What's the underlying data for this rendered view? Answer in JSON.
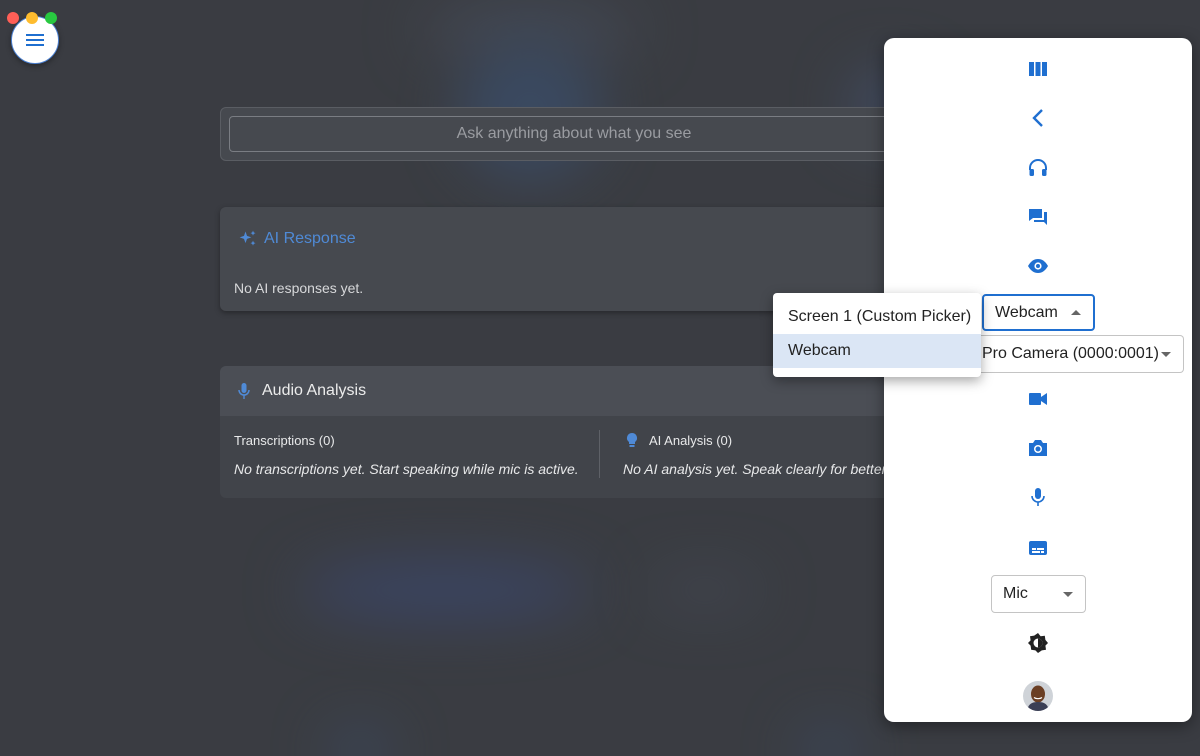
{
  "window_controls": [
    "close",
    "minimize",
    "maximize"
  ],
  "menu_button": {
    "icon": "hamburger-menu-icon"
  },
  "ask": {
    "placeholder": "Ask anything about what you see"
  },
  "ai_response": {
    "title": "AI Response",
    "icon": "sparkle-icon",
    "empty_text": "No AI responses yet."
  },
  "audio_analysis": {
    "title": "Audio Analysis",
    "transcriptions_header": "Transcriptions (0)",
    "transcriptions_empty": "No transcriptions yet. Start speaking while mic is active.",
    "ai_analysis_header": "AI Analysis (0)",
    "ai_analysis_empty": "No AI analysis yet. Speak clearly for better"
  },
  "side_panel": {
    "icons": [
      "columns-icon",
      "chevron-left-icon",
      "headset-icon",
      "forum-icon",
      "eye-icon",
      "videocam-icon",
      "camera-icon",
      "mic-icon",
      "subtitles-icon",
      "brightness-icon"
    ],
    "source_select": {
      "value": "Webcam"
    },
    "camera_select": {
      "value": "Pro Camera (0000:0001)"
    },
    "audio_select": {
      "value": "Mic"
    }
  },
  "source_dropdown": {
    "options": [
      "Screen 1 (Custom Picker)",
      "Webcam"
    ],
    "selected": "Webcam"
  },
  "colors": {
    "accent": "#1f6fd0",
    "ai_title": "#4f8ad6",
    "panel_bg": "#ffffff",
    "backdrop": "#3a3d43"
  }
}
